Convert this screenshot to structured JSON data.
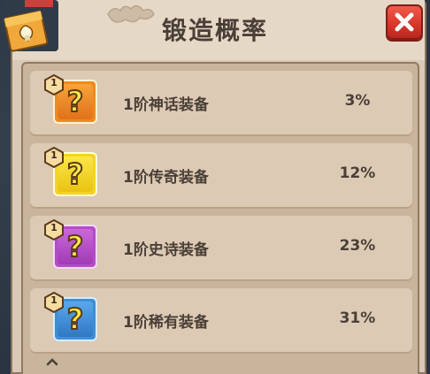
{
  "title": "锻造概率",
  "colors": {
    "panel": "#d9c9b6",
    "row": "#dccab5",
    "text": "#4a3f37",
    "close_button": "#d8342a"
  },
  "close_icon": "close-x-icon",
  "rows": [
    {
      "level": "1",
      "name": "1阶神话装备",
      "percent": "3%",
      "icon": "question-mark-icon",
      "rarity_color": "#f08a1e"
    },
    {
      "level": "1",
      "name": "1阶传奇装备",
      "percent": "12%",
      "icon": "question-mark-icon",
      "rarity_color": "#f4d41f"
    },
    {
      "level": "1",
      "name": "1阶史诗装备",
      "percent": "23%",
      "icon": "question-mark-icon",
      "rarity_color": "#b44cc6"
    },
    {
      "level": "1",
      "name": "1阶稀有装备",
      "percent": "31%",
      "icon": "question-mark-icon",
      "rarity_color": "#3e8fd8"
    }
  ]
}
